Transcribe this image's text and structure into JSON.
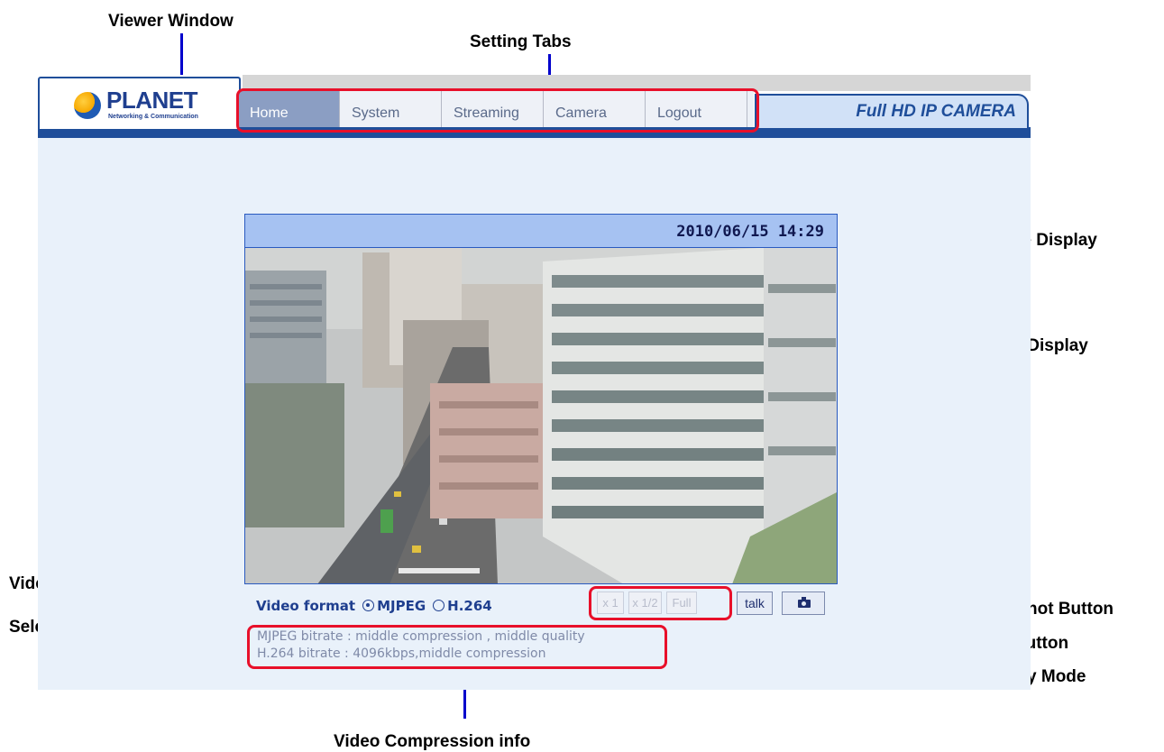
{
  "annotations": {
    "viewer_window": "Viewer Window",
    "setting_tabs": "Setting Tabs",
    "time_display_1": "Time Display",
    "time_display_2": "Time Display",
    "video_format_1": "Video Format",
    "video_format_2": "Selection",
    "snapshot_button": "Snapshot Button",
    "talk_button": "Talk Button",
    "display_mode": "Display Mode",
    "compression_info": "Video Compression info"
  },
  "header": {
    "logo_text": "PLANET",
    "logo_sub": "Networking & Communication",
    "brand": "Full HD IP CAMERA"
  },
  "tabs": [
    {
      "label": "Home",
      "active": true
    },
    {
      "label": "System",
      "active": false
    },
    {
      "label": "Streaming",
      "active": false
    },
    {
      "label": "Camera",
      "active": false
    },
    {
      "label": "Logout",
      "active": false
    }
  ],
  "timestamp": "2010/06/15 14:29",
  "video_format": {
    "label": "Video format",
    "options": [
      "MJPEG",
      "H.264"
    ],
    "selected": "MJPEG"
  },
  "display_mode": {
    "buttons": [
      "x 1",
      "x 1/2",
      "Full"
    ]
  },
  "talk_label": "talk",
  "snapshot_icon": "camera-icon",
  "compression": {
    "mjpeg": "MJPEG bitrate : middle compression , middle quality",
    "h264": "H.264 bitrate : 4096kbps,middle compression"
  },
  "colors": {
    "annotation_line": "#0000cc",
    "highlight": "#e8102a",
    "theme_blue": "#1f4e9a",
    "active_tab": "#8b9ec3"
  }
}
